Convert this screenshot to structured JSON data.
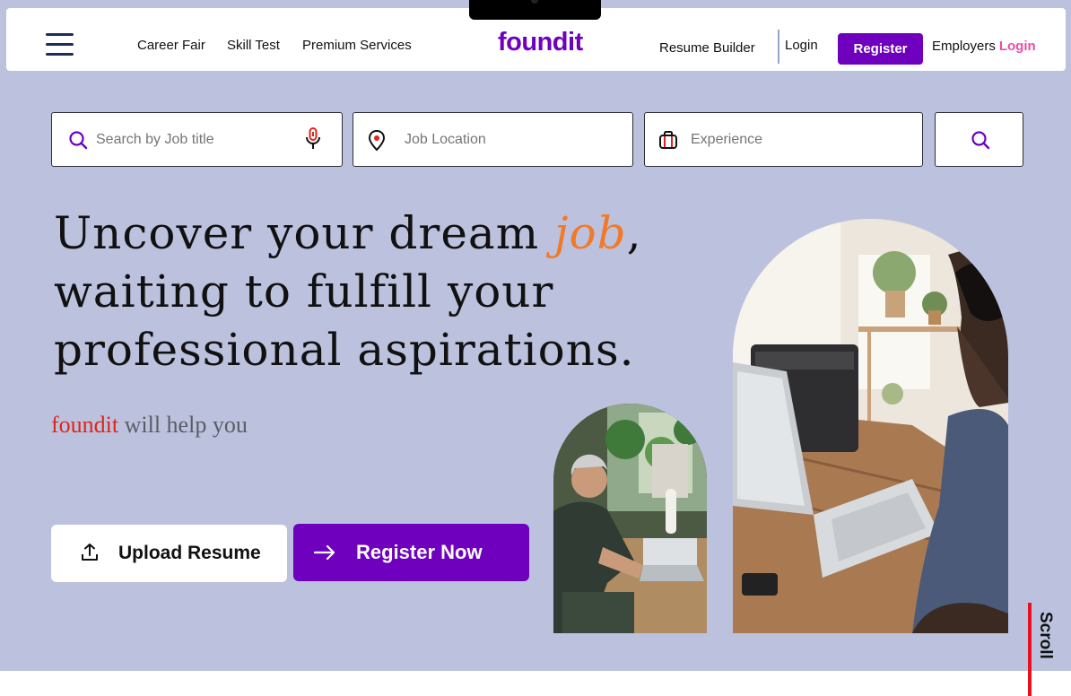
{
  "header": {
    "nav": [
      "Career Fair",
      "Skill Test",
      "Premium Services"
    ],
    "logo": "foundit",
    "resume_builder": "Resume Builder",
    "login": "Login",
    "register": "Register",
    "employers": "Employers",
    "employers_login": "Login"
  },
  "search": {
    "job_title_placeholder": "Search by Job title",
    "location_placeholder": "Job Location",
    "experience_placeholder": "Experience"
  },
  "hero": {
    "headline_part1": "Uncover your dream ",
    "headline_accent": "job",
    "headline_part2": ", waiting to fulfill your professional aspirations.",
    "tagline_brand": "foundit",
    "tagline_rest": " will help you",
    "upload_resume": "Upload Resume",
    "register_now": "Register Now"
  },
  "scroll_label": "Scroll",
  "colors": {
    "brand_purple": "#6e00be",
    "hero_background": "#bcc2de",
    "accent_orange": "#f07a2a",
    "brand_red": "#e0241a",
    "employer_pink": "#f04aa5"
  },
  "icons": [
    "menu-icon",
    "search-icon",
    "microphone-icon",
    "location-pin-icon",
    "briefcase-icon",
    "upload-icon",
    "arrow-right-icon"
  ]
}
